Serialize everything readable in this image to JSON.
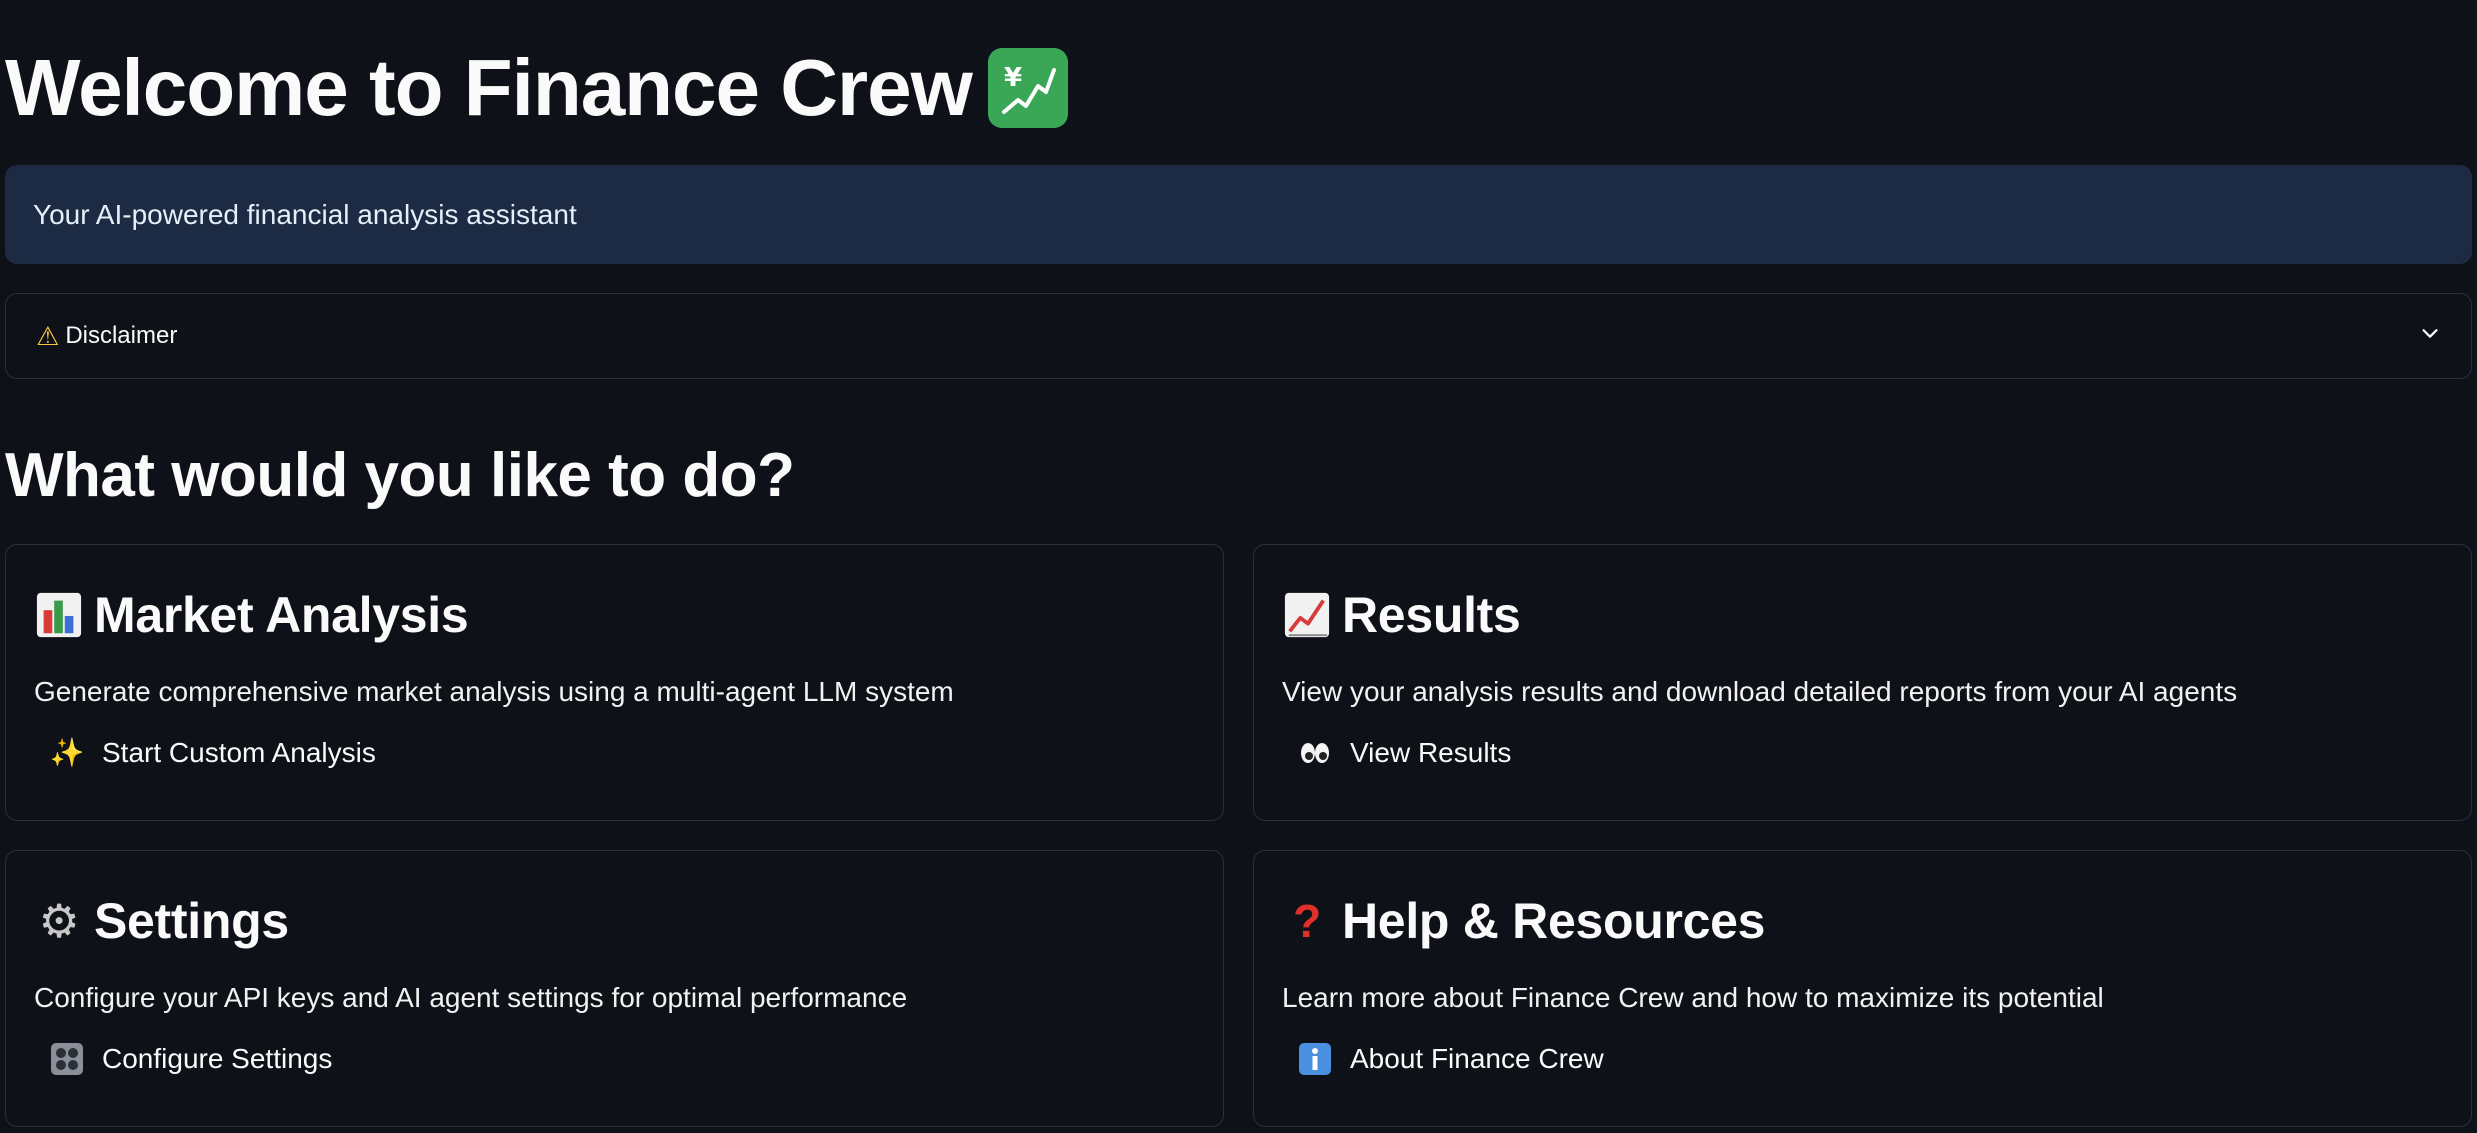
{
  "header": {
    "title": "Welcome to Finance Crew",
    "title_icon": "chart-yen-icon",
    "subtitle": "Your AI-powered financial analysis assistant"
  },
  "disclaimer": {
    "icon": "warning-icon",
    "label": "Disclaimer"
  },
  "section_heading": "What would you like to do?",
  "cards": [
    {
      "icon": "bar-chart-icon",
      "title": "Market Analysis",
      "description": "Generate comprehensive market analysis using a multi-agent LLM system",
      "button_icon": "sparkles-icon",
      "button_label": "Start Custom Analysis"
    },
    {
      "icon": "trending-up-chart-icon",
      "title": "Results",
      "description": "View your analysis results and download detailed reports from your AI agents",
      "button_icon": "eyes-icon",
      "button_label": "View Results"
    },
    {
      "icon": "gear-icon",
      "title": "Settings",
      "description": "Configure your API keys and AI agent settings for optimal performance",
      "button_icon": "control-knobs-icon",
      "button_label": "Configure Settings"
    },
    {
      "icon": "question-mark-icon",
      "title": "Help & Resources",
      "description": "Learn more about Finance Crew and how to maximize its potential",
      "button_icon": "info-icon",
      "button_label": "About Finance Crew"
    }
  ],
  "colors": {
    "background": "#0e1117",
    "info_box": "#1c2b43",
    "border": "#2a2f3a",
    "text": "#fafafa"
  }
}
